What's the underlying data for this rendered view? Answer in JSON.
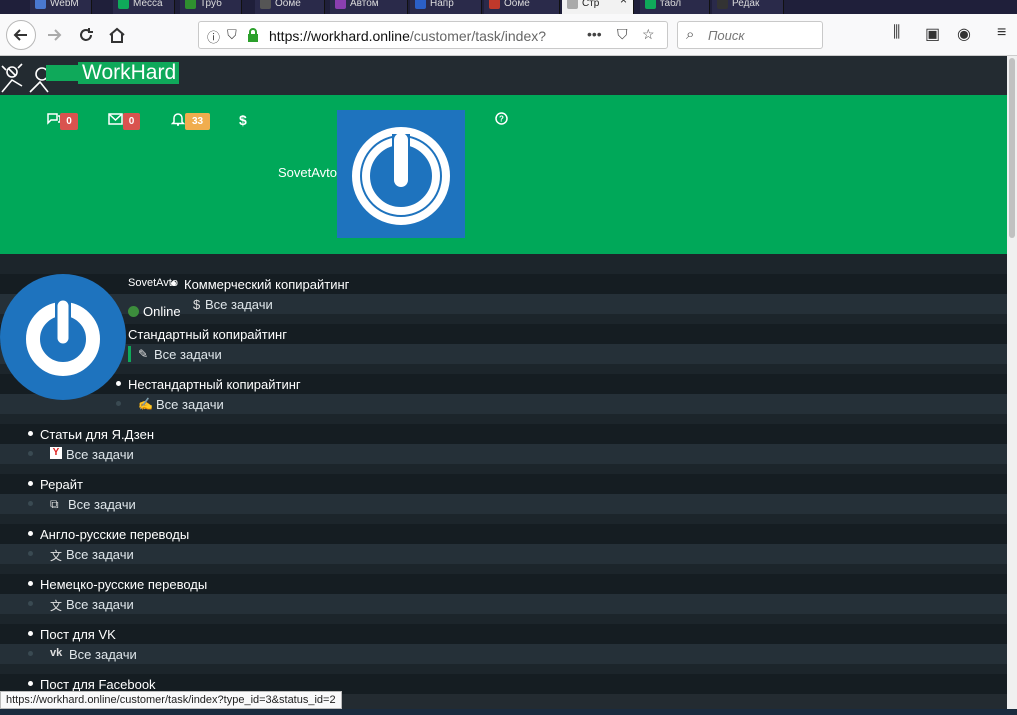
{
  "browser": {
    "tabs": [
      {
        "label": "WebM",
        "color": "#4a78d0"
      },
      {
        "label": "Месса",
        "color": "#0fa95a"
      },
      {
        "label": "Труб",
        "color": "#2f8f2f"
      },
      {
        "label": "Ооме",
        "color": "#444"
      },
      {
        "label": "Автом",
        "color": "#8b3fb0"
      },
      {
        "label": "Напр",
        "color": "#2b60c8"
      },
      {
        "label": "Ооме",
        "color": "#c0392b"
      },
      {
        "label": "Стр",
        "color": "#aaa"
      },
      {
        "label": "табл",
        "color": "#0fa95a"
      },
      {
        "label": "Редак",
        "color": "#333"
      }
    ],
    "url_host": "https://workhard.online",
    "url_path": "/customer/task/index?",
    "search_placeholder": "Поиск"
  },
  "site": {
    "brand": "WorkHard",
    "header": {
      "comments_count": "0",
      "messages_count": "0",
      "notifications_count": "33",
      "username": "SovetAvto"
    }
  },
  "profile": {
    "name": "SovetAvto",
    "status": "Online"
  },
  "menu": {
    "categories": [
      {
        "label": "Коммерческий копирайтинг",
        "sub": "Все задачи",
        "icon": "dollar-icon"
      },
      {
        "label": "Стандартный копирайтинг",
        "sub": "Все задачи",
        "icon": "pencil-icon"
      },
      {
        "label": "Нестандартный копирайтинг",
        "sub": "Все задачи",
        "icon": "edit-icon"
      },
      {
        "label": "Статьи для Я.Дзен",
        "sub": "Все задачи",
        "icon": "yandex-icon"
      },
      {
        "label": "Рерайт",
        "sub": "Все задачи",
        "icon": "copy-icon"
      },
      {
        "label": "Англо-русские переводы",
        "sub": "Все задачи",
        "icon": "translate-icon"
      },
      {
        "label": "Немецко-русские переводы",
        "sub": "Все задачи",
        "icon": "translate-icon"
      },
      {
        "label": "Пост для VK",
        "sub": "Все задачи",
        "icon": "vk-icon"
      },
      {
        "label": "Пост для Facebook",
        "sub": "",
        "icon": ""
      }
    ]
  },
  "status_bar": "https://workhard.online/customer/task/index?type_id=3&status_id=2"
}
